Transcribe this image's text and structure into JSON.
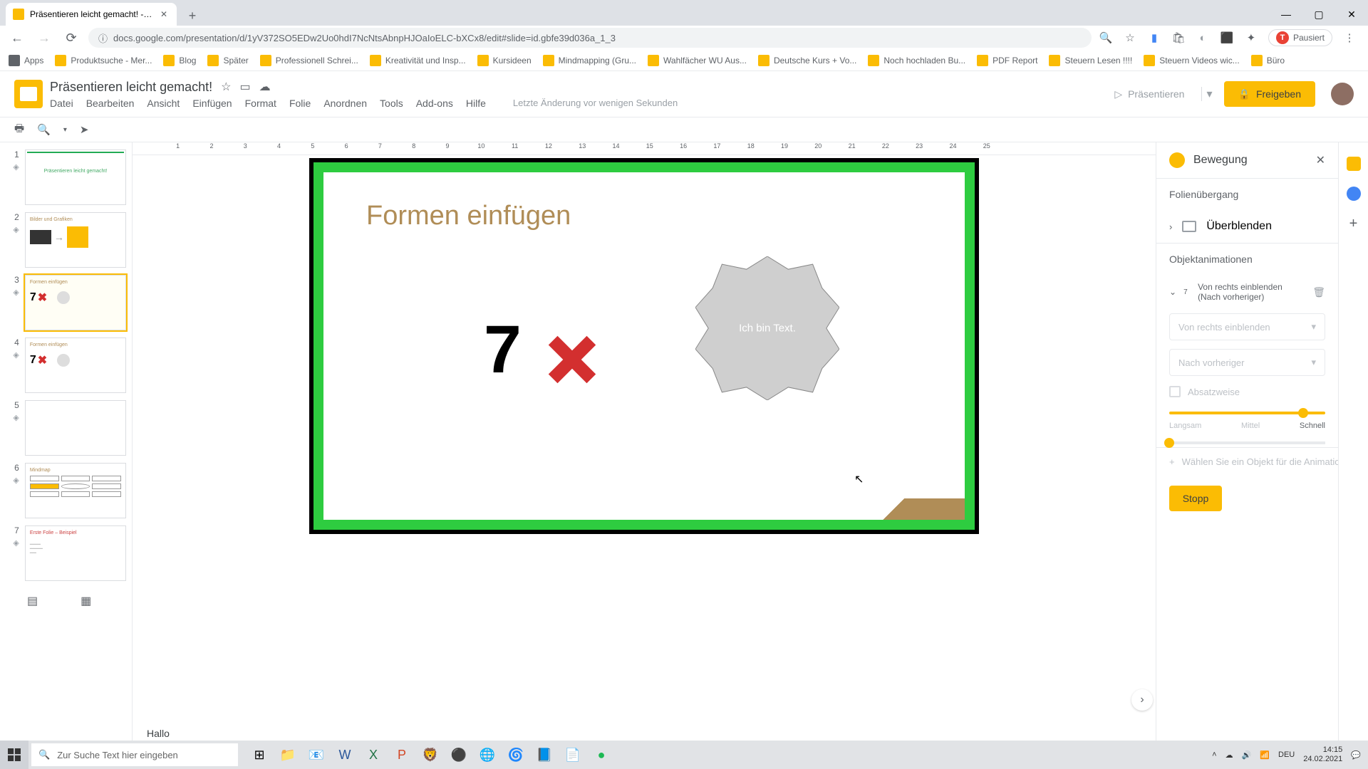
{
  "browser": {
    "tab_title": "Präsentieren leicht gemacht! - G...",
    "url": "docs.google.com/presentation/d/1yV372SO5EDw2Uo0hdI7NcNtsAbnpHJOaIoELC-bXCx8/edit#slide=id.gbfe39d036a_1_3",
    "pause_label": "Pausiert",
    "pause_initial": "T"
  },
  "bookmarks": [
    "Apps",
    "Produktsuche - Mer...",
    "Blog",
    "Später",
    "Professionell Schrei...",
    "Kreativität und Insp...",
    "Kursideen",
    "Mindmapping  (Gru...",
    "Wahlfächer WU Aus...",
    "Deutsche Kurs + Vo...",
    "Noch hochladen Bu...",
    "PDF Report",
    "Steuern Lesen !!!!",
    "Steuern Videos wic...",
    "Büro"
  ],
  "doc": {
    "title": "Präsentieren leicht gemacht!",
    "menus": [
      "Datei",
      "Bearbeiten",
      "Ansicht",
      "Einfügen",
      "Format",
      "Folie",
      "Anordnen",
      "Tools",
      "Add-ons",
      "Hilfe"
    ],
    "last_edit": "Letzte Änderung vor wenigen Sekunden",
    "present": "Präsentieren",
    "share": "Freigeben"
  },
  "ruler": [
    "1",
    "2",
    "3",
    "4",
    "5",
    "6",
    "7",
    "8",
    "9",
    "10",
    "11",
    "12",
    "13",
    "14",
    "15",
    "16",
    "17",
    "18",
    "19",
    "20",
    "21",
    "22",
    "23",
    "24",
    "25"
  ],
  "slide": {
    "heading": "Formen einfügen",
    "seven": "7",
    "seal_text": "Ich bin Text.",
    "notes": "Hallo"
  },
  "thumbs": {
    "t1": "Präsentieren leicht gemacht!",
    "t2": "Bilder und Grafiken",
    "t3": "Formen einfügen",
    "t4": "Formen einfügen",
    "t6": "Mindmap",
    "t7": "Erste Folie – Beispiel"
  },
  "panel": {
    "title": "Bewegung",
    "transition_hd": "Folienübergang",
    "transition_type": "Überblenden",
    "obj_anim_hd": "Objektanimationen",
    "anim_badge": "7",
    "anim_line1": "Von rechts einblenden",
    "anim_line2": "(Nach vorheriger)",
    "sel1": "Von rechts einblenden",
    "sel2": "Nach vorheriger",
    "check": "Absatzweise",
    "slow": "Langsam",
    "mid": "Mittel",
    "fast": "Schnell",
    "add_obj": "Wählen Sie ein Objekt für die Animatio",
    "stop": "Stopp"
  },
  "taskbar": {
    "search": "Zur Suche Text hier eingeben",
    "lang": "DEU",
    "time": "14:15",
    "date": "24.02.2021"
  }
}
